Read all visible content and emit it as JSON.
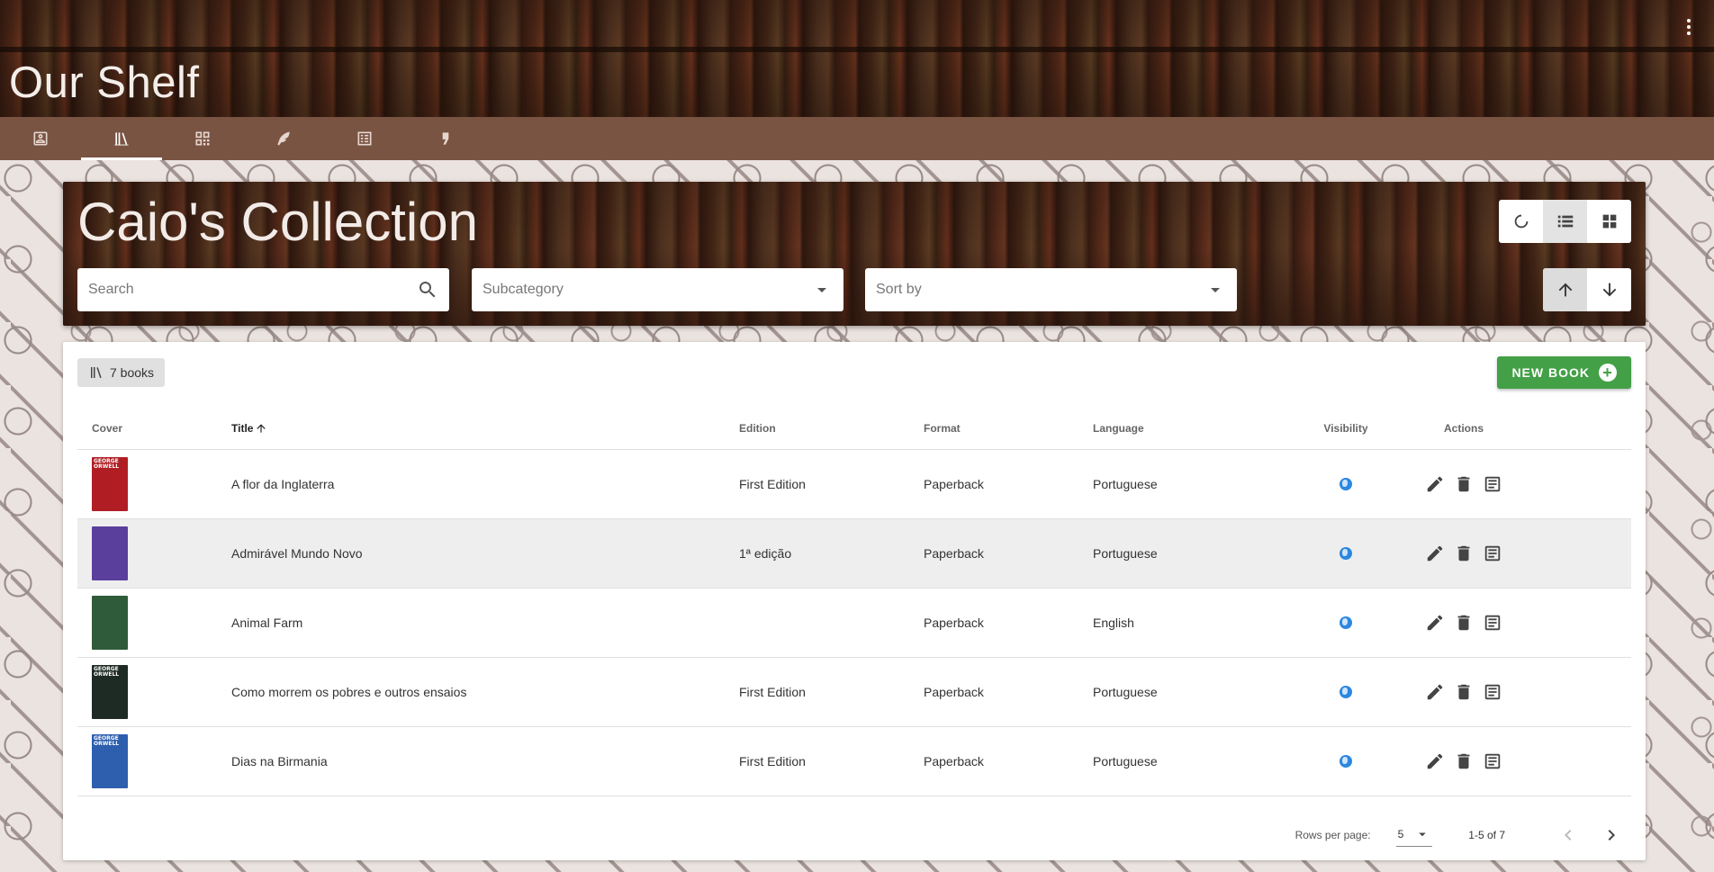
{
  "app": {
    "title": "Our Shelf"
  },
  "tabs": [
    {
      "icon": "profile-icon",
      "active": false
    },
    {
      "icon": "library-icon",
      "active": true
    },
    {
      "icon": "dashboard-icon",
      "active": false
    },
    {
      "icon": "pen-icon",
      "active": false
    },
    {
      "icon": "building-icon",
      "active": false
    },
    {
      "icon": "quote-icon",
      "active": false
    }
  ],
  "collection": {
    "title": "Caio's Collection",
    "search_placeholder": "Search",
    "subcategory_placeholder": "Subcategory",
    "sortby_placeholder": "Sort by"
  },
  "table": {
    "count_label": "7 books",
    "new_book_label": "NEW BOOK",
    "headers": {
      "cover": "Cover",
      "title": "Title",
      "edition": "Edition",
      "format": "Format",
      "language": "Language",
      "visibility": "Visibility",
      "actions": "Actions"
    },
    "rows": [
      {
        "title": "A flor da Inglaterra",
        "edition": "First Edition",
        "format": "Paperback",
        "language": "Portuguese",
        "cover_color": "#b01e24",
        "cover_text": "GEORGE ORWELL"
      },
      {
        "title": "Admirável Mundo Novo",
        "edition": "1ª edição",
        "format": "Paperback",
        "language": "Portuguese",
        "cover_color": "#5a3f9c",
        "cover_text": ""
      },
      {
        "title": "Animal Farm",
        "edition": "",
        "format": "Paperback",
        "language": "English",
        "cover_color": "#2f5b3a",
        "cover_text": ""
      },
      {
        "title": "Como morrem os pobres e outros ensaios",
        "edition": "First Edition",
        "format": "Paperback",
        "language": "Portuguese",
        "cover_color": "#1e2a24",
        "cover_text": "GEORGE ORWELL"
      },
      {
        "title": "Dias na Birmania",
        "edition": "First Edition",
        "format": "Paperback",
        "language": "Portuguese",
        "cover_color": "#2d5fae",
        "cover_text": "GEORGE ORWELL"
      }
    ]
  },
  "pager": {
    "rows_per_page_label": "Rows per page:",
    "rows_per_page_value": "5",
    "range": "1-5 of 7"
  },
  "colors": {
    "tab_bar": "#7a5443",
    "accent_green": "#43a047",
    "globe_blue": "#2b87e0"
  }
}
